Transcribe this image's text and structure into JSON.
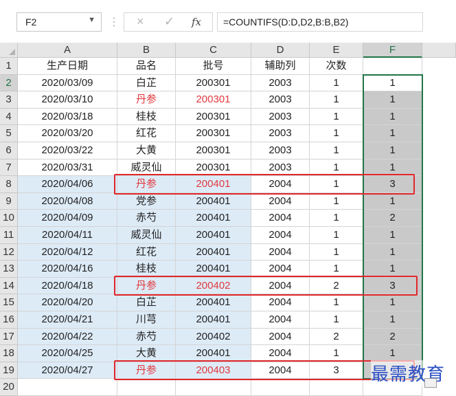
{
  "formula_bar": {
    "name_box": "F2",
    "cancel_icon": "×",
    "enter_icon": "✓",
    "fx_label": "fx",
    "formula": "=COUNTIFS(D:D,D2,B:B,B2)"
  },
  "columns": [
    "A",
    "B",
    "C",
    "D",
    "E",
    "F"
  ],
  "row_numbers": [
    "1",
    "2",
    "3",
    "4",
    "5",
    "6",
    "7",
    "8",
    "9",
    "10",
    "11",
    "12",
    "13",
    "14",
    "15",
    "16",
    "17",
    "18",
    "19",
    "20"
  ],
  "header_row": [
    "生产日期",
    "品名",
    "批号",
    "辅助列",
    "次数",
    ""
  ],
  "rows": [
    [
      "2020/03/09",
      "白芷",
      "200301",
      "2003",
      "1",
      "1"
    ],
    [
      "2020/03/10",
      "丹参",
      "200301",
      "2003",
      "1",
      "1"
    ],
    [
      "2020/03/18",
      "桂枝",
      "200301",
      "2003",
      "1",
      "1"
    ],
    [
      "2020/03/20",
      "红花",
      "200301",
      "2003",
      "1",
      "1"
    ],
    [
      "2020/03/22",
      "大黄",
      "200301",
      "2003",
      "1",
      "1"
    ],
    [
      "2020/03/31",
      "威灵仙",
      "200301",
      "2003",
      "1",
      "1"
    ],
    [
      "2020/04/06",
      "丹参",
      "200401",
      "2004",
      "1",
      "3"
    ],
    [
      "2020/04/08",
      "党参",
      "200401",
      "2004",
      "1",
      "1"
    ],
    [
      "2020/04/09",
      "赤芍",
      "200401",
      "2004",
      "1",
      "2"
    ],
    [
      "2020/04/11",
      "威灵仙",
      "200401",
      "2004",
      "1",
      "1"
    ],
    [
      "2020/04/12",
      "红花",
      "200401",
      "2004",
      "1",
      "1"
    ],
    [
      "2020/04/16",
      "桂枝",
      "200401",
      "2004",
      "1",
      "1"
    ],
    [
      "2020/04/18",
      "丹参",
      "200402",
      "2004",
      "2",
      "3"
    ],
    [
      "2020/04/20",
      "白芷",
      "200401",
      "2004",
      "1",
      "1"
    ],
    [
      "2020/04/21",
      "川芎",
      "200401",
      "2004",
      "1",
      "1"
    ],
    [
      "2020/04/22",
      "赤芍",
      "200402",
      "2004",
      "2",
      "2"
    ],
    [
      "2020/04/25",
      "大黄",
      "200401",
      "2004",
      "1",
      "1"
    ],
    [
      "2020/04/27",
      "丹参",
      "200403",
      "2004",
      "3",
      ""
    ]
  ],
  "red_text_rows": [
    2,
    7,
    13,
    18
  ],
  "highlighted_rows": [
    7,
    13,
    18
  ],
  "watermark": "最需教育",
  "colors": {
    "accent_green": "#217346",
    "red_text": "#e0393e",
    "highlight_red": "#e0262b",
    "blue_fill": "#ddebf7",
    "gray_fill": "#c9c9c9",
    "watermark_blue": "#2b4fc4"
  }
}
